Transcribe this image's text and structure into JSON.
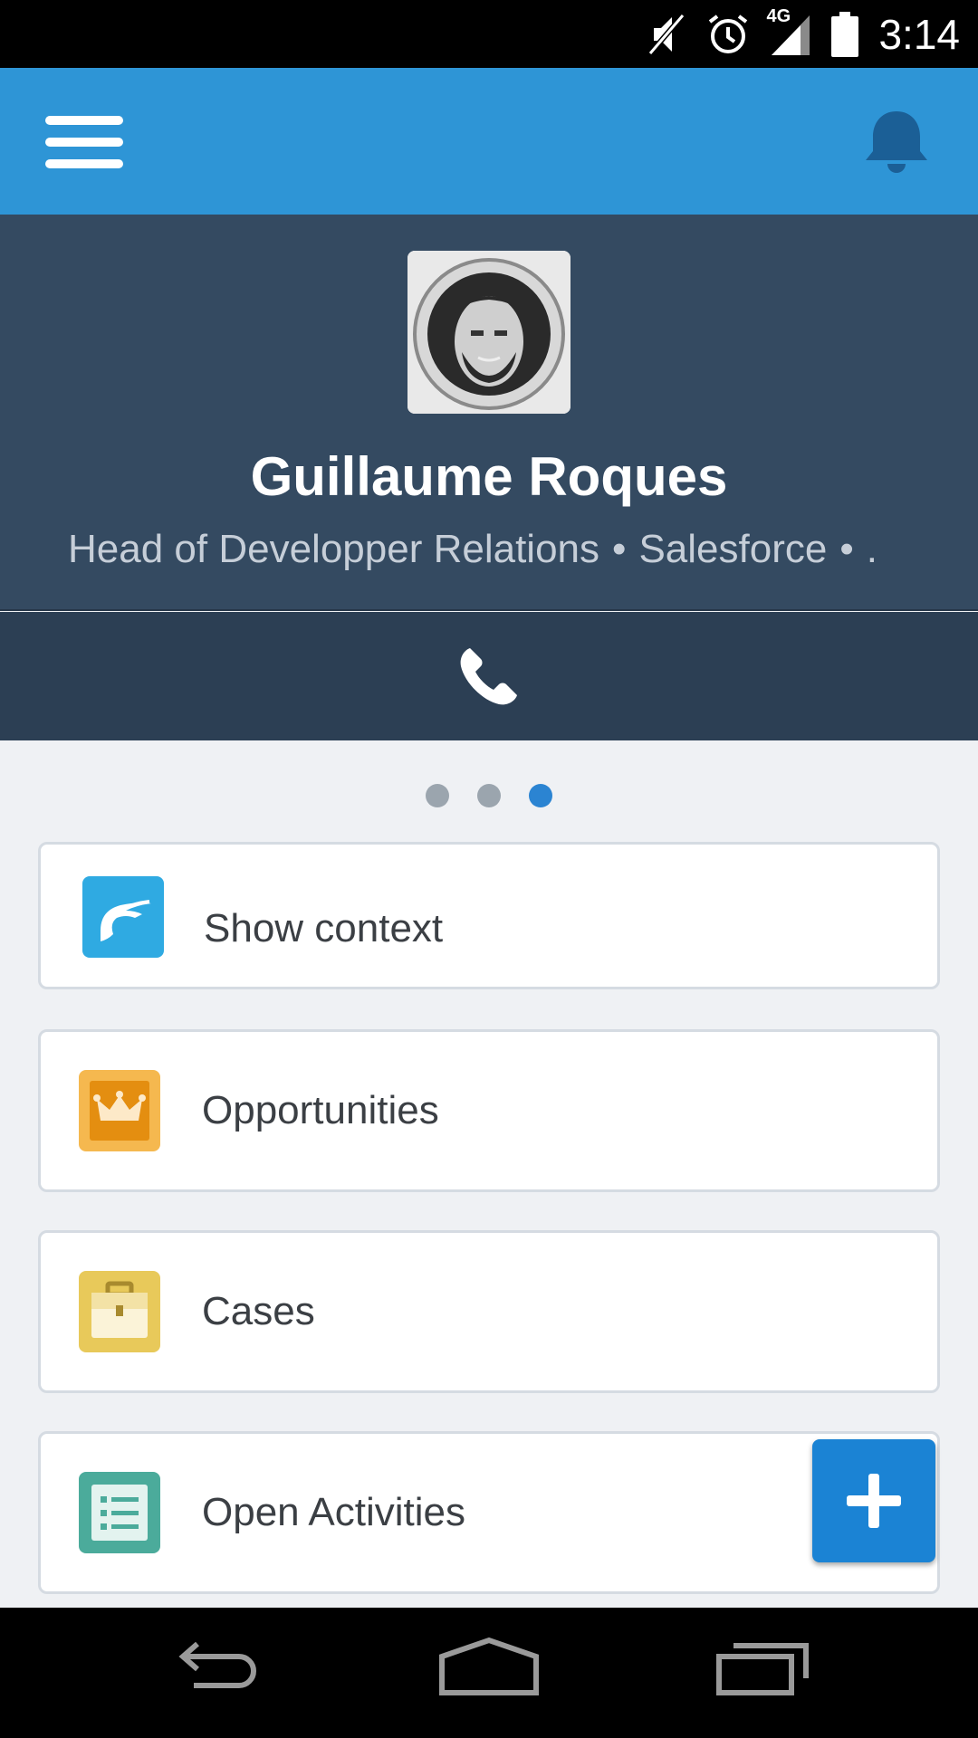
{
  "status_bar": {
    "time": "3:14",
    "network": "4G",
    "icons": [
      "mute-icon",
      "alarm-icon",
      "signal-icon",
      "battery-icon"
    ]
  },
  "header": {
    "menu_icon": "hamburger-menu-icon",
    "notification_icon": "bell-icon",
    "color": "#2e95d6"
  },
  "profile": {
    "name": "Guillaume Roques",
    "title": "Head of Developper Relations",
    "company": "Salesforce",
    "trailing": ".",
    "separator": "•",
    "background": "#344a61"
  },
  "actions": {
    "phone_icon": "phone-icon"
  },
  "pager": {
    "count": 3,
    "active_index": 2
  },
  "cards": [
    {
      "label": "Show context",
      "icon": "context-icon",
      "color": "#2faae2"
    },
    {
      "label": "Opportunities",
      "icon": "crown-icon",
      "color": "#f5b84f"
    },
    {
      "label": "Cases",
      "icon": "briefcase-icon",
      "color": "#e8c95a"
    },
    {
      "label": "Open Activities",
      "icon": "list-icon",
      "color": "#4bab9b"
    }
  ],
  "fab": {
    "icon": "plus-icon",
    "color": "#1b83d4"
  },
  "nav_bar": {
    "icons": [
      "back-icon",
      "home-icon",
      "recents-icon"
    ]
  }
}
